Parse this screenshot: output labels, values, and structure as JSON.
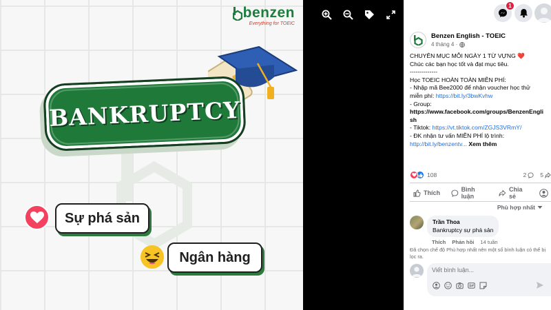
{
  "post_image": {
    "brand": {
      "name": "benzen",
      "tagline": "Everything for TOEIC"
    },
    "word": "BANKRUPTCY",
    "meaning": "Sự phá sản",
    "category": "Ngân hàng"
  },
  "viewer": {
    "controls": [
      "zoom-in-icon",
      "zoom-out-icon",
      "tag-icon",
      "fullscreen-icon"
    ]
  },
  "topbar": {
    "messenger_badge": "1"
  },
  "post": {
    "page_name": "Benzen English - TOEIC",
    "time": "4 tháng 4 ·",
    "lines": [
      {
        "text": "CHUYÊN MỤC MỖI NGÀY 1 TỪ VỰNG ",
        "emoji": "❤️"
      },
      {
        "text": "Chúc các bạn học tốt và đạt mục tiêu."
      },
      {
        "text": "--------------"
      },
      {
        "text": "Học TOEIC HOÀN TOÀN MIỄN PHÍ:"
      },
      {
        "text": "- Nhập mã Bee2000 để nhận voucher học thử"
      },
      {
        "text": "miễn phí: ",
        "link": "https://bit.ly/3bwKvhw"
      },
      {
        "text": "- Group:"
      },
      {
        "text": "https://www.facebook.com/groups/BenzenEngli",
        "bold": true
      },
      {
        "text": "sh",
        "bold": true
      },
      {
        "text": "- Tiktok: ",
        "link": "https://vt.tiktok.com/ZGJS3VRmY/"
      },
      {
        "text": "- ĐK nhận tư vấn MIỄN PHÍ lộ trình:"
      },
      {
        "text": "",
        "link": "http://bit.ly/benzentv...",
        "see_more": " Xem thêm"
      }
    ],
    "reactions_count": "108",
    "comments_count": "2",
    "shares_count": "5"
  },
  "actions": {
    "like": "Thích",
    "comment": "Bình luận",
    "share": "Chia sẻ"
  },
  "sort_label": "Phù hợp nhất",
  "comment": {
    "author": "Trần Thoa",
    "text": "Bankruptcy sự phá sản",
    "like": "Thích",
    "reply": "Phản hồi",
    "age": "14 tuần"
  },
  "notice": "Đã chọn chế độ Phù hợp nhất nên một số bình luận có thể bị lọc ra.",
  "composer": {
    "placeholder": "Viết bình luận..."
  },
  "colors": {
    "brand_green": "#1f7a3a",
    "fb_blue": "#1877f2",
    "love_red": "#f33e58"
  }
}
